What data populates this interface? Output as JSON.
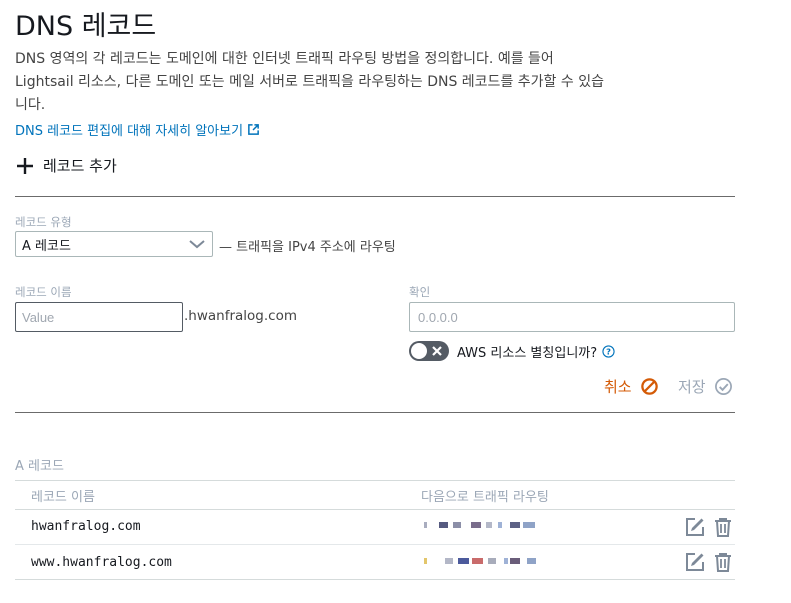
{
  "header": {
    "title": "DNS 레코드",
    "description": "DNS 영역의 각 레코드는 도메인에 대한 인터넷 트래픽 라우팅 방법을 정의합니다. 예를 들어 Lightsail 리소스, 다른 도메인 또는 메일 서버로 트래픽을 라우팅하는 DNS 레코드를 추가할 수 있습니다.",
    "learn_more": "DNS 레코드 편집에 대해 자세히 알아보기"
  },
  "add_record": {
    "label": "레코드 추가"
  },
  "form": {
    "record_type": {
      "label": "레코드 유형",
      "selected": "A 레코드",
      "hint": "— 트래픽을 IPv4 주소에 라우팅"
    },
    "record_name": {
      "label": "레코드 이름",
      "placeholder": "Value",
      "suffix": ".hwanfralog.com"
    },
    "confirm": {
      "label": "확인",
      "placeholder": "0.0.0.0"
    },
    "alias_toggle": {
      "label": "AWS 리소스 별칭입니까?"
    },
    "cancel_label": "취소",
    "save_label": "저장"
  },
  "records": {
    "section_title": "A 레코드",
    "columns": [
      "레코드 이름",
      "다음으로 트래픽 라우팅"
    ],
    "rows": [
      {
        "name": "hwanfralog.com"
      },
      {
        "name": "www.hwanfralog.com"
      }
    ]
  },
  "colors": {
    "link": "#0073bb",
    "cancel": "#d45b07",
    "muted": "#9ba7b6",
    "toggle_off": "#545b64"
  },
  "icons": [
    "external-link-icon",
    "plus-icon",
    "chevron-down-icon",
    "toggle-x-icon",
    "help-icon",
    "cancel-icon",
    "check-icon",
    "edit-icon",
    "trash-icon"
  ]
}
